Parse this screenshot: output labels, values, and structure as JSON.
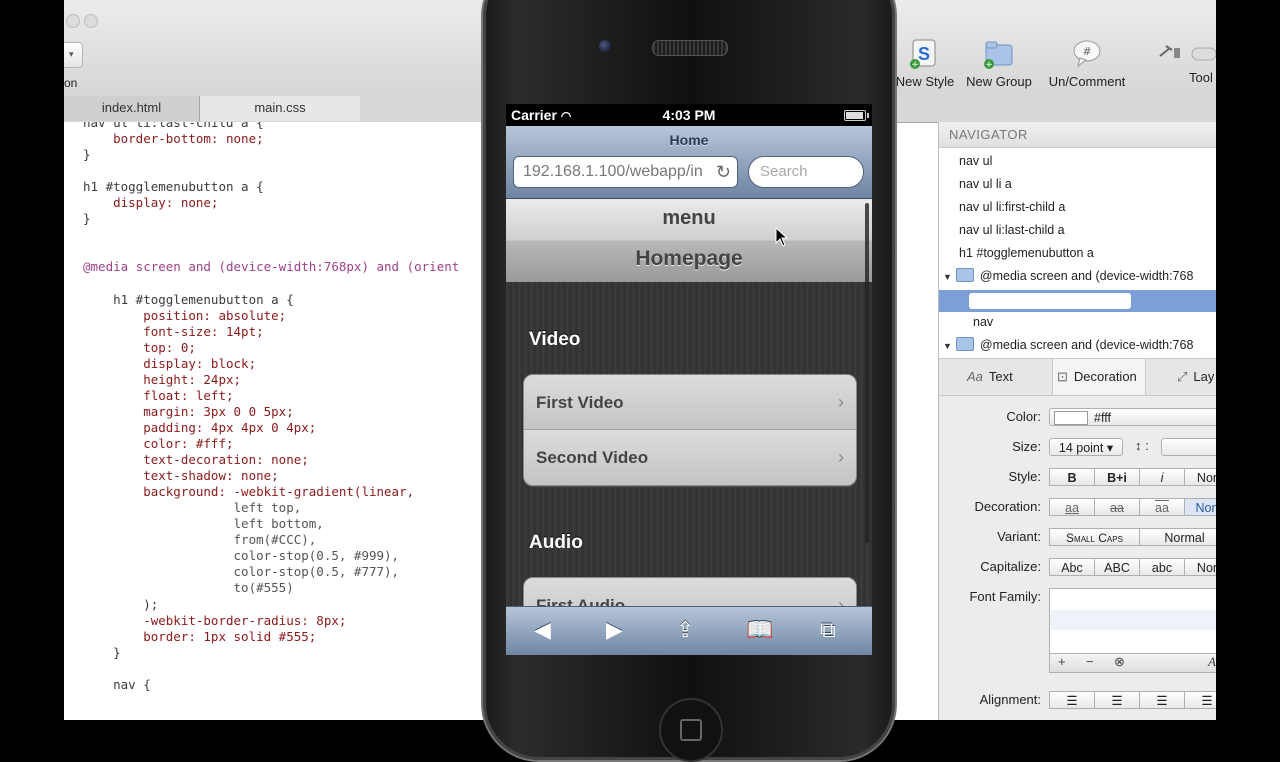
{
  "toolbar": {
    "left_label": "on",
    "items": [
      {
        "label": "New Style",
        "icon": "new-style-icon"
      },
      {
        "label": "New Group",
        "icon": "new-group-icon"
      },
      {
        "label": "Un/Comment",
        "icon": "comment-icon"
      },
      {
        "label": "Tool",
        "icon": "tools-icon"
      }
    ]
  },
  "tabs": [
    "index.html",
    "main.css"
  ],
  "code_lines": [
    {
      "t": "nav ul li:last-child a {",
      "c": "sel"
    },
    {
      "t": "    border-bottom: none;",
      "c": "prop"
    },
    {
      "t": "}",
      "c": "plain"
    },
    {
      "t": "",
      "c": "plain"
    },
    {
      "t": "h1 #togglemenubutton a {",
      "c": "sel"
    },
    {
      "t": "    display: none;",
      "c": "prop"
    },
    {
      "t": "}",
      "c": "plain"
    },
    {
      "t": "",
      "c": "plain"
    },
    {
      "t": "",
      "c": "plain"
    },
    {
      "t": "@media screen and (device-width:768px) and (orient",
      "c": "kw"
    },
    {
      "t": "",
      "c": "plain"
    },
    {
      "t": "    h1 #togglemenubutton a {",
      "c": "sel"
    },
    {
      "t": "        position: absolute;",
      "c": "prop"
    },
    {
      "t": "        font-size: 14pt;",
      "c": "prop"
    },
    {
      "t": "        top: 0;",
      "c": "prop"
    },
    {
      "t": "        display: block;",
      "c": "prop"
    },
    {
      "t": "        height: 24px;",
      "c": "prop"
    },
    {
      "t": "        float: left;",
      "c": "prop"
    },
    {
      "t": "        margin: 3px 0 0 5px;",
      "c": "prop"
    },
    {
      "t": "        padding: 4px 4px 0 4px;",
      "c": "prop"
    },
    {
      "t": "        color: #fff;",
      "c": "prop"
    },
    {
      "t": "        text-decoration: none;",
      "c": "prop"
    },
    {
      "t": "        text-shadow: none;",
      "c": "prop"
    },
    {
      "t": "        background: -webkit-gradient(linear,",
      "c": "prop"
    },
    {
      "t": "                    left top,",
      "c": "val"
    },
    {
      "t": "                    left bottom,",
      "c": "val"
    },
    {
      "t": "                    from(#CCC),",
      "c": "val"
    },
    {
      "t": "                    color-stop(0.5, #999),",
      "c": "val"
    },
    {
      "t": "                    color-stop(0.5, #777),",
      "c": "val"
    },
    {
      "t": "                    to(#555)",
      "c": "val"
    },
    {
      "t": "        );",
      "c": "plain"
    },
    {
      "t": "        -webkit-border-radius: 8px;",
      "c": "prop"
    },
    {
      "t": "        border: 1px solid #555;",
      "c": "prop"
    },
    {
      "t": "    }",
      "c": "plain"
    },
    {
      "t": "",
      "c": "plain"
    },
    {
      "t": "    nav {",
      "c": "sel"
    }
  ],
  "navigator": {
    "title": "NAVIGATOR",
    "items": [
      "nav ul",
      "nav ul li a",
      "nav ul li:first-child a",
      "nav ul li:last-child a",
      "h1 #togglemenubutton a"
    ],
    "folder1": "@media screen and (device-width:768",
    "sub": "nav",
    "folder2": "@media screen and (device-width:768"
  },
  "inspector": {
    "tabs": [
      "Text",
      "Decoration",
      "Lay"
    ],
    "color_label": "Color:",
    "color_value": "#fff",
    "size_label": "Size:",
    "size_value": "14 point ▾",
    "style_label": "Style:",
    "style_opts": [
      "B",
      "B+i",
      "i",
      "Nor"
    ],
    "decoration_label": "Decoration:",
    "decoration_opts": [
      "aa",
      "aa",
      "aa",
      "Non"
    ],
    "variant_label": "Variant:",
    "variant_opts": [
      "Small Caps",
      "Normal"
    ],
    "capitalize_label": "Capitalize:",
    "capitalize_opts": [
      "Abc",
      "ABC",
      "abc",
      "Nor"
    ],
    "family_label": "Font Family:",
    "alignment_label": "Alignment:"
  },
  "phone": {
    "carrier": "Carrier",
    "time": "4:03 PM",
    "page_title": "Home",
    "url": "192.168.1.100/webapp/in",
    "search_placeholder": "Search",
    "menu": "menu",
    "heading": "Homepage",
    "sections": [
      {
        "title": "Video",
        "items": [
          "First Video",
          "Second Video"
        ]
      },
      {
        "title": "Audio",
        "items": [
          "First Audio"
        ]
      }
    ]
  }
}
